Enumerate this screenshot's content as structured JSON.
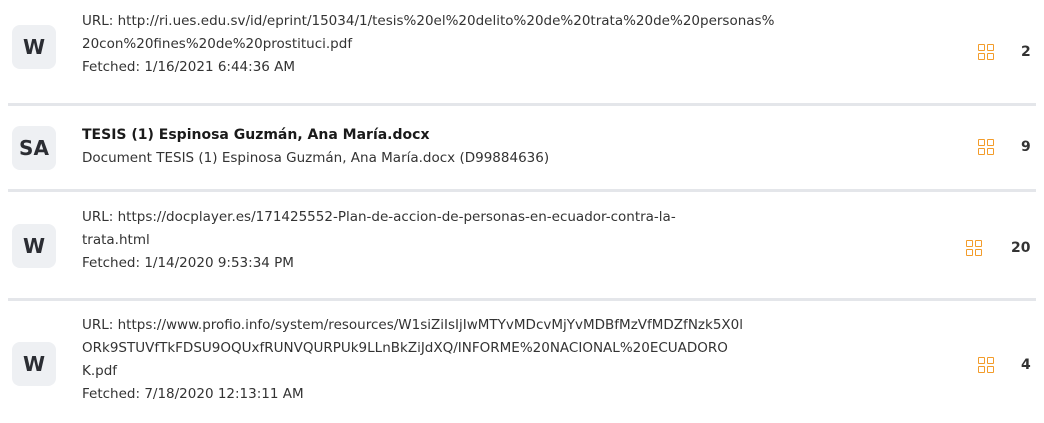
{
  "results": [
    {
      "badge": "W",
      "lines": [
        "URL: http://ri.ues.edu.sv/id/eprint/15034/1/tesis%20el%20delito%20de%20trata%20de%20personas%",
        "20con%20fines%20de%20prostituci.pdf",
        "Fetched: 1/16/2021 6:44:36 AM"
      ],
      "count": "2"
    },
    {
      "badge": "SA",
      "title": "TESIS (1) Espinosa Guzmán, Ana María.docx",
      "lines": [
        "Document TESIS (1) Espinosa Guzmán, Ana María.docx (D99884636)"
      ],
      "count": "9"
    },
    {
      "badge": "W",
      "lines": [
        "URL: https://docplayer.es/171425552-Plan-de-accion-de-personas-en-ecuador-contra-la-",
        "trata.html",
        "Fetched: 1/14/2020 9:53:34 PM"
      ],
      "count": "20"
    },
    {
      "badge": "W",
      "lines": [
        "URL: https://www.profio.info/system/resources/W1siZiIsIjIwMTYvMDcvMjYvMDBfMzVfMDZfNzk5X0l",
        "ORk9STUVfTkFDSU9OQUxfRUNVQURPUk9LLnBkZiJdXQ/INFORME%20NACIONAL%20ECUADORO",
        "K.pdf",
        "Fetched: 7/18/2020 12:13:11 AM"
      ],
      "count": "4"
    }
  ],
  "icon_color": "#f39c2a"
}
